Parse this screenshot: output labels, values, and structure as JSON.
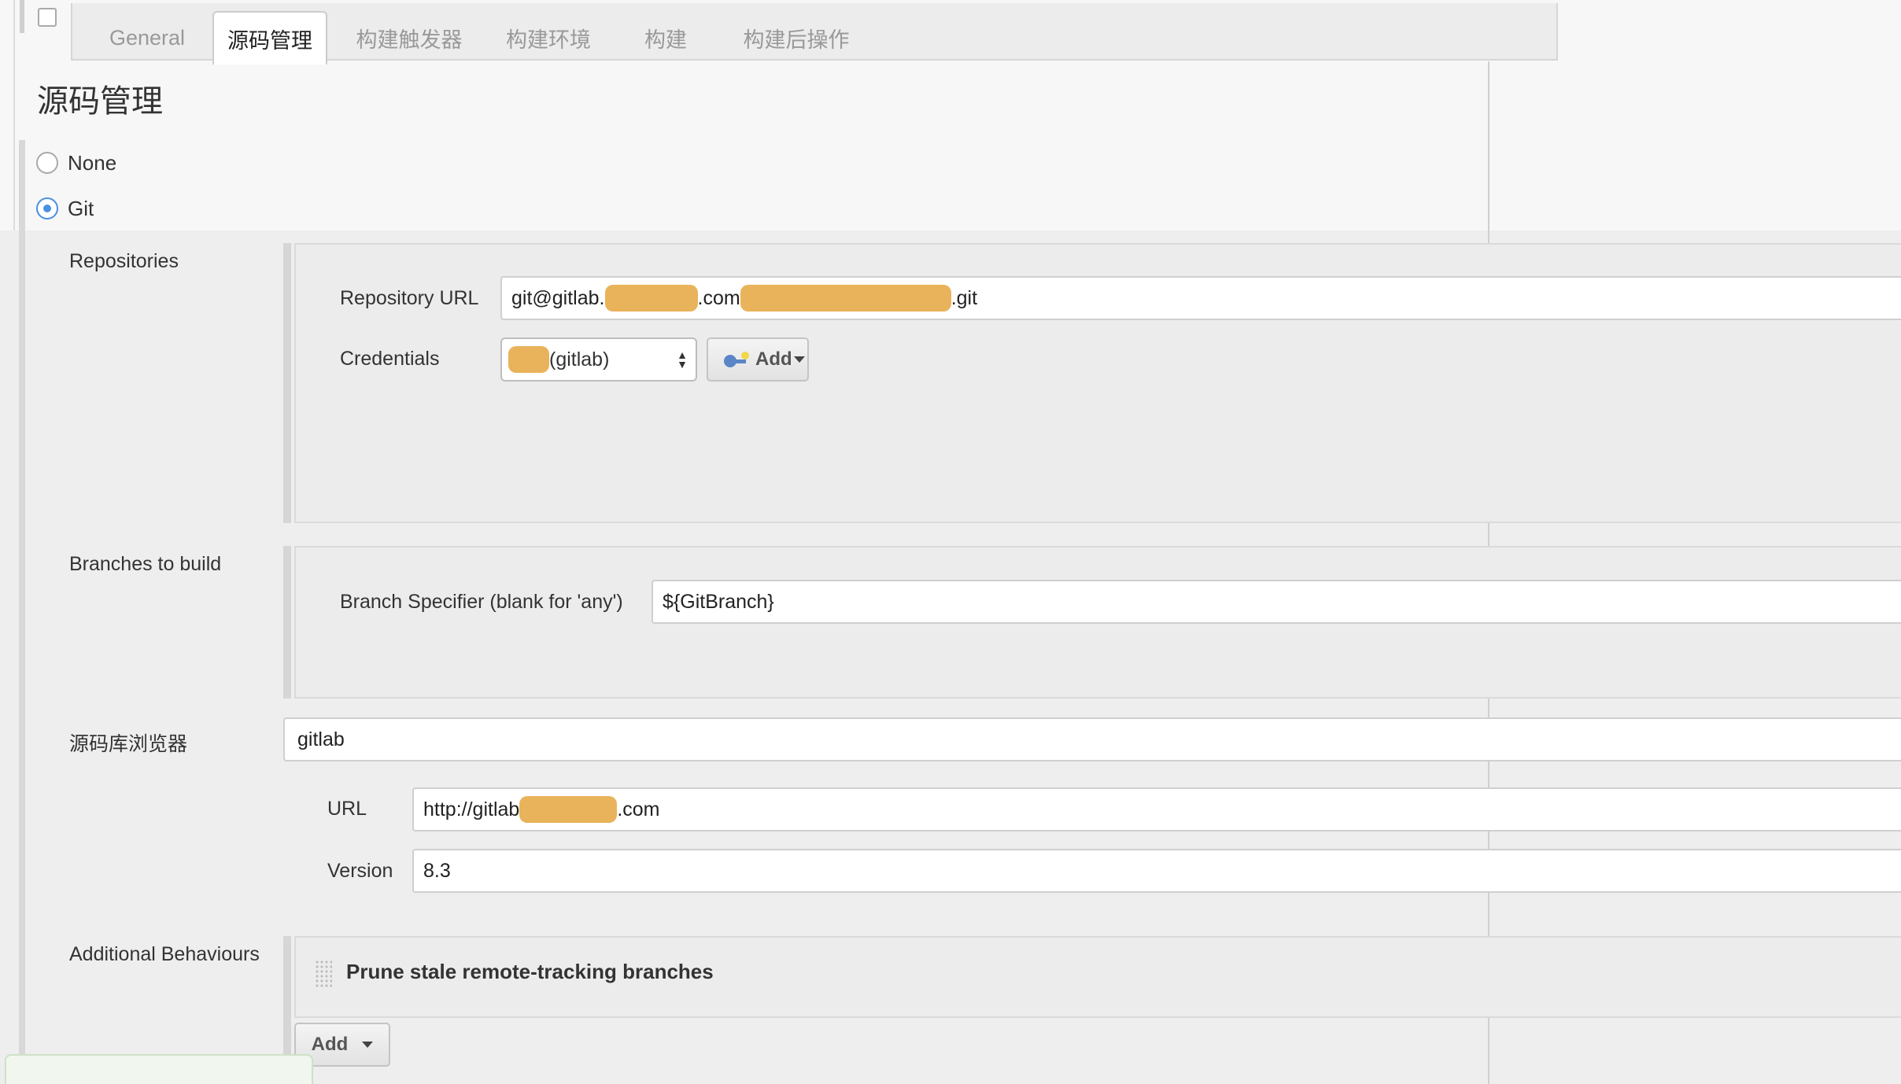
{
  "tabs": [
    {
      "label": "General",
      "active": false
    },
    {
      "label": "源码管理",
      "active": true
    },
    {
      "label": "构建触发器",
      "active": false
    },
    {
      "label": "构建环境",
      "active": false
    },
    {
      "label": "构建",
      "active": false
    },
    {
      "label": "构建后操作",
      "active": false
    }
  ],
  "section_title": "源码管理",
  "scm": {
    "options": [
      {
        "label": "None",
        "selected": false
      },
      {
        "label": "Git",
        "selected": true
      }
    ]
  },
  "repositories": {
    "label": "Repositories",
    "url_label": "Repository URL",
    "url_value": {
      "prefix": "git@gitlab.",
      "middle": ".com",
      "suffix": ".git"
    },
    "credentials_label": "Credentials",
    "credentials_value": "(gitlab)",
    "add_button": "Add"
  },
  "branches": {
    "label": "Branches to build",
    "specifier_label": "Branch Specifier (blank for 'any')",
    "specifier_value": "${GitBranch}"
  },
  "browser": {
    "label": "源码库浏览器",
    "value": "gitlab",
    "url_label": "URL",
    "url_value": {
      "prefix": "http://gitlab",
      "suffix": ".com"
    },
    "version_label": "Version",
    "version_value": "8.3"
  },
  "behaviours": {
    "label": "Additional Behaviours",
    "item": "Prune stale remote-tracking branches",
    "add_button": "Add"
  },
  "colors": {
    "accent": "#4a90e2",
    "redaction": "#e9b35b"
  }
}
